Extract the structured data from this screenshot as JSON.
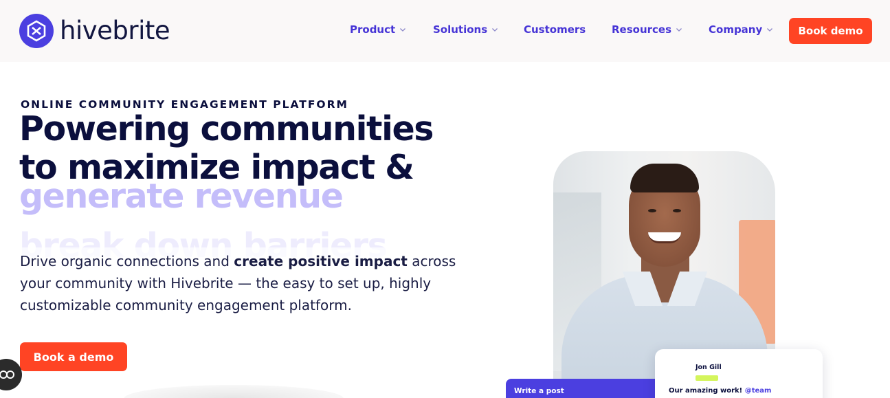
{
  "header": {
    "logo_text": "hivebrite",
    "nav": [
      {
        "label": "Product",
        "has_dropdown": true
      },
      {
        "label": "Solutions",
        "has_dropdown": true
      },
      {
        "label": "Customers",
        "has_dropdown": false
      },
      {
        "label": "Resources",
        "has_dropdown": true
      },
      {
        "label": "Company",
        "has_dropdown": true
      }
    ],
    "cta_label": "Book demo"
  },
  "hero": {
    "eyebrow": "ONLINE COMMUNITY ENGAGEMENT PLATFORM",
    "headline_line1": "Powering communities",
    "headline_line2": "to maximize impact &",
    "rotating_phrase_active": "generate revenue",
    "rotating_phrase_next": "break down barriers",
    "lead_part1": "Drive organic connections and ",
    "lead_bold": "create positive impact",
    "lead_part2": " across your community with Hivebrite — the easy to set up, highly customizable community engagement platform.",
    "cta_label": "Book a demo"
  },
  "overlay": {
    "post_label": "Write a post",
    "comment_name": "Jon Gill",
    "comment_text": "Our amazing work! ",
    "comment_mention": "@team"
  },
  "colors": {
    "brand_purple": "#4b3fe0",
    "nav_text": "#4634d6",
    "cta_red": "#ff4424",
    "heading": "#0b0f3d",
    "rotator": "#c4bdfa",
    "highlight_tag": "#d4f55c"
  },
  "icons": {
    "logo": "hivebrite-hexagon-logo-icon",
    "dropdown": "chevron-down-icon",
    "cookie": "cookie-settings-icon"
  }
}
